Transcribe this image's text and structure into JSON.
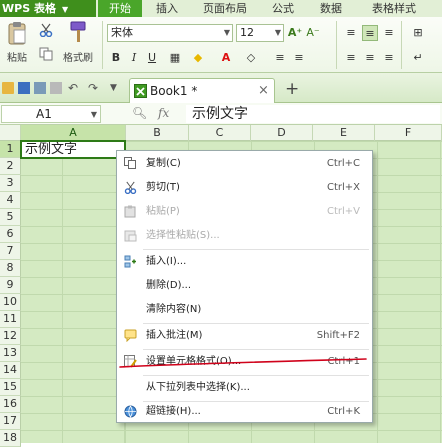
{
  "app": {
    "name": "WPS 表格"
  },
  "ribbon_tabs": [
    "开始",
    "插入",
    "页面布局",
    "公式",
    "数据",
    "表格样式"
  ],
  "ribbon": {
    "paste_label": "粘贴",
    "format_painter_label": "格式刷",
    "font_name": "宋体",
    "font_size": "12"
  },
  "document": {
    "tab_name": "Book1 *"
  },
  "formula_bar": {
    "cell_ref": "A1",
    "fx": "fx",
    "content": "示例文字"
  },
  "columns": [
    "A",
    "B",
    "C",
    "D",
    "E",
    "F"
  ],
  "rows": [
    "1",
    "2",
    "3",
    "4",
    "5",
    "6",
    "7",
    "8",
    "9",
    "10",
    "11",
    "12",
    "13",
    "14",
    "15",
    "16",
    "17",
    "18"
  ],
  "cells": {
    "A1": "示例文字"
  },
  "context_menu": {
    "items": [
      {
        "label": "复制(C)",
        "shortcut": "Ctrl+C",
        "icon": "copy-icon",
        "disabled": false
      },
      {
        "label": "剪切(T)",
        "shortcut": "Ctrl+X",
        "icon": "cut-icon",
        "disabled": false
      },
      {
        "label": "粘贴(P)",
        "shortcut": "Ctrl+V",
        "icon": "paste-icon",
        "disabled": true
      },
      {
        "label": "选择性粘贴(S)...",
        "shortcut": "",
        "icon": "paste-special-icon",
        "disabled": true
      },
      {
        "label": "插入(I)...",
        "shortcut": "",
        "icon": "insert-icon",
        "disabled": false
      },
      {
        "label": "删除(D)...",
        "shortcut": "",
        "icon": "",
        "disabled": false
      },
      {
        "label": "清除内容(N)",
        "shortcut": "",
        "icon": "",
        "disabled": false
      },
      {
        "label": "插入批注(M)",
        "shortcut": "Shift+F2",
        "icon": "comment-icon",
        "disabled": false
      },
      {
        "label": "设置单元格格式(O)...",
        "shortcut": "Ctrl+1",
        "icon": "format-cells-icon",
        "disabled": false
      },
      {
        "label": "从下拉列表中选择(K)...",
        "shortcut": "",
        "icon": "",
        "disabled": false
      },
      {
        "label": "超链接(H)...",
        "shortcut": "Ctrl+K",
        "icon": "hyperlink-icon",
        "disabled": false
      }
    ]
  },
  "colors": {
    "brand": "#3f8f1c",
    "grid_bg": "#d4eac2",
    "annotation": "#d0021b"
  }
}
